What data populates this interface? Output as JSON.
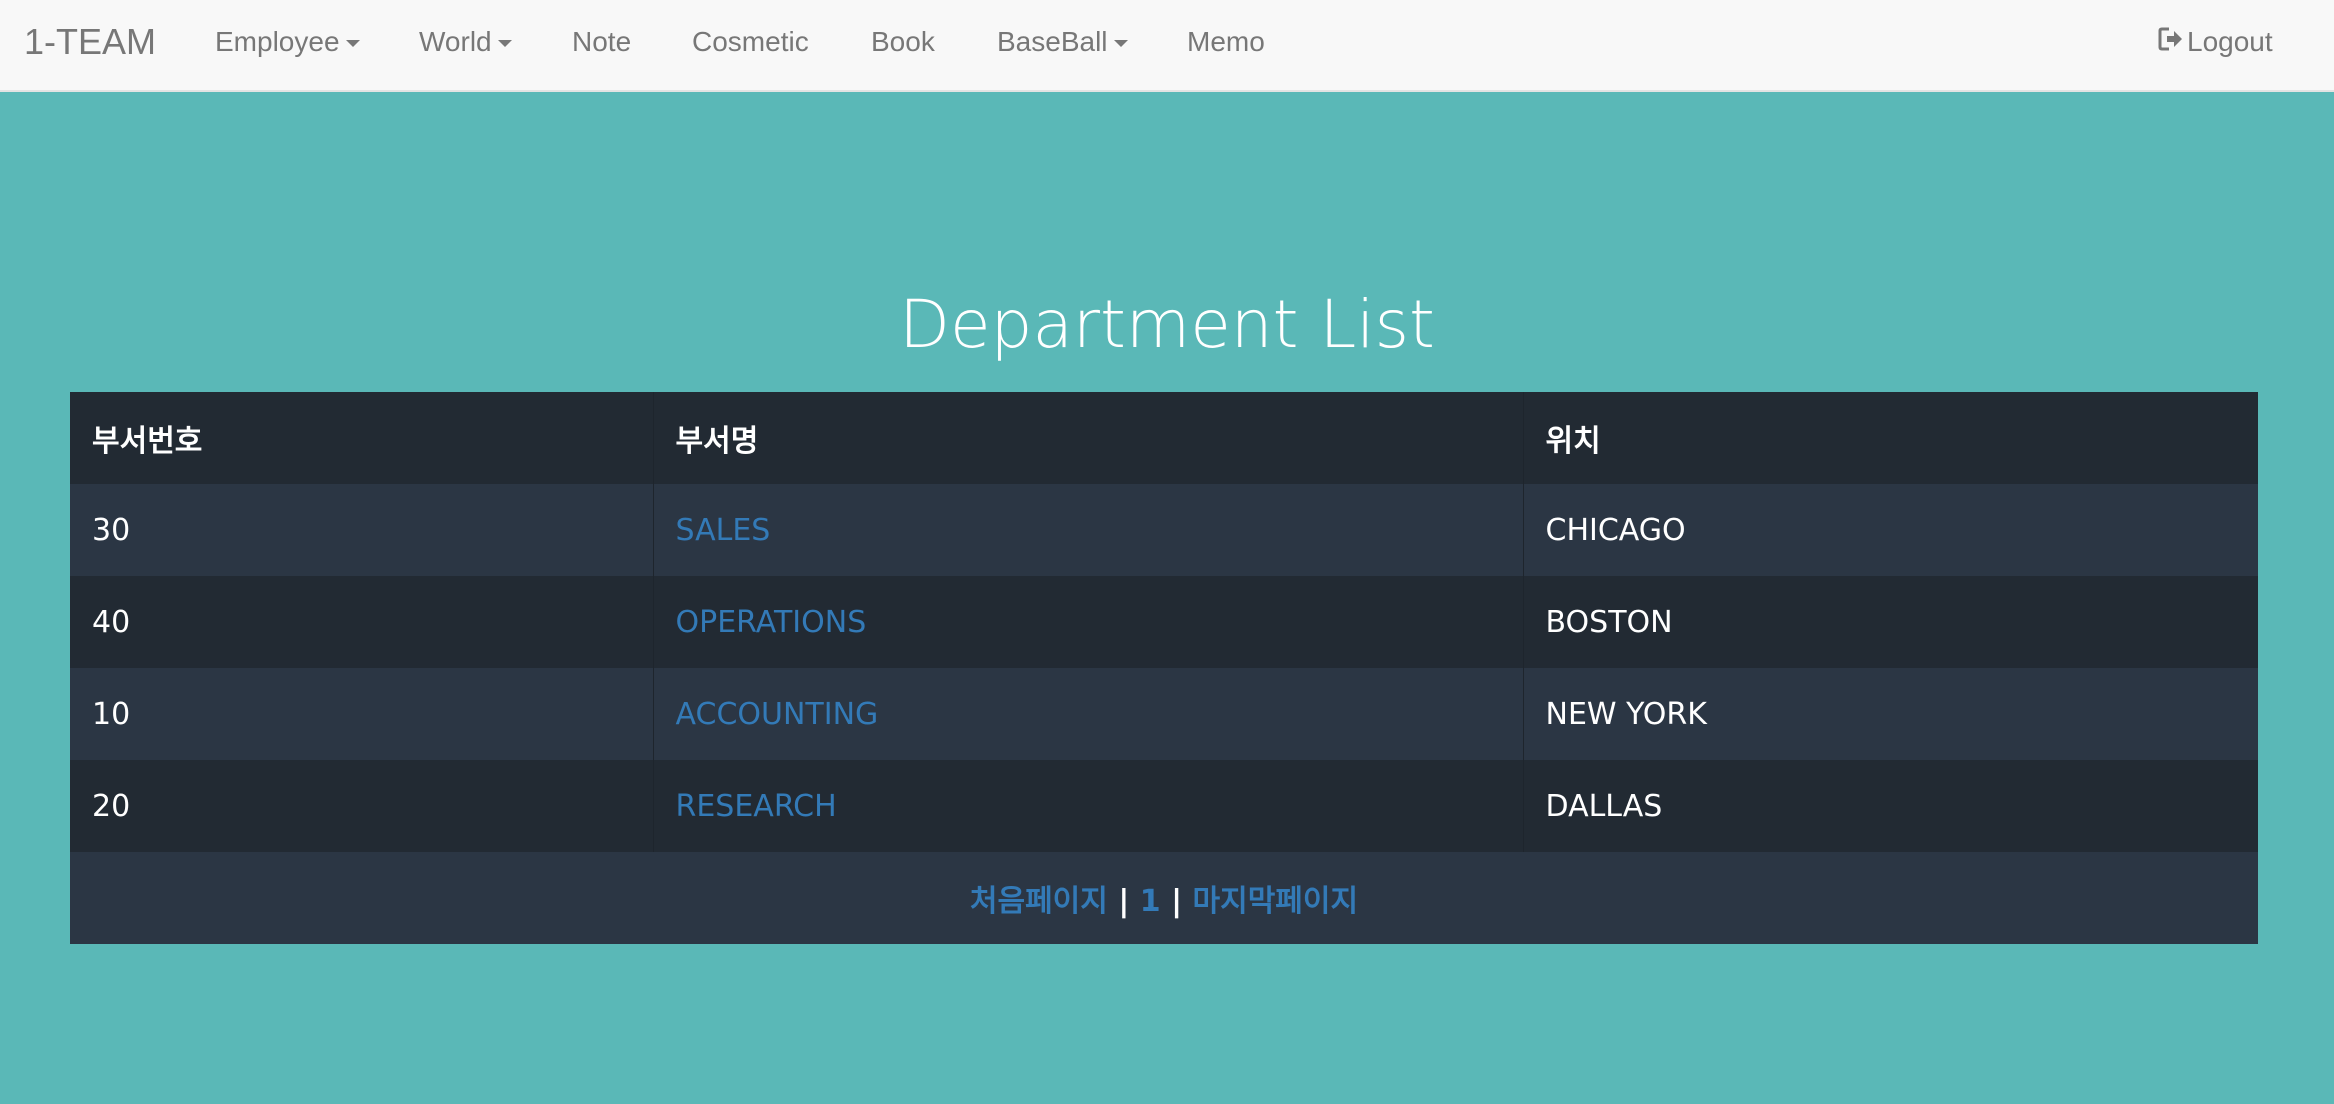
{
  "navbar": {
    "brand": "1-TEAM",
    "items": [
      {
        "label": "Employee",
        "dropdown": true
      },
      {
        "label": "World",
        "dropdown": true
      },
      {
        "label": "Note",
        "dropdown": false
      },
      {
        "label": "Cosmetic",
        "dropdown": false
      },
      {
        "label": "Book",
        "dropdown": false
      },
      {
        "label": "BaseBall",
        "dropdown": true
      },
      {
        "label": "Memo",
        "dropdown": false
      }
    ],
    "logout": {
      "label": "Logout",
      "icon": "logout-icon"
    }
  },
  "page": {
    "title": "Department List"
  },
  "table": {
    "headers": [
      "부서번호",
      "부서명",
      "위치"
    ],
    "rows": [
      {
        "deptno": "30",
        "dname": "SALES",
        "loc": "CHICAGO"
      },
      {
        "deptno": "40",
        "dname": "OPERATIONS",
        "loc": "BOSTON"
      },
      {
        "deptno": "10",
        "dname": "ACCOUNTING",
        "loc": "NEW YORK"
      },
      {
        "deptno": "20",
        "dname": "RESEARCH",
        "loc": "DALLAS"
      }
    ]
  },
  "pager": {
    "first": "처음페이지",
    "separator": "|",
    "pages": [
      "1"
    ],
    "last": "마지막페이지"
  },
  "colors": {
    "background": "#5ab8b7",
    "navbar": "#f8f8f8",
    "table_dark": "#222a33",
    "table_alt": "#2b3644",
    "link": "#337ab7"
  }
}
